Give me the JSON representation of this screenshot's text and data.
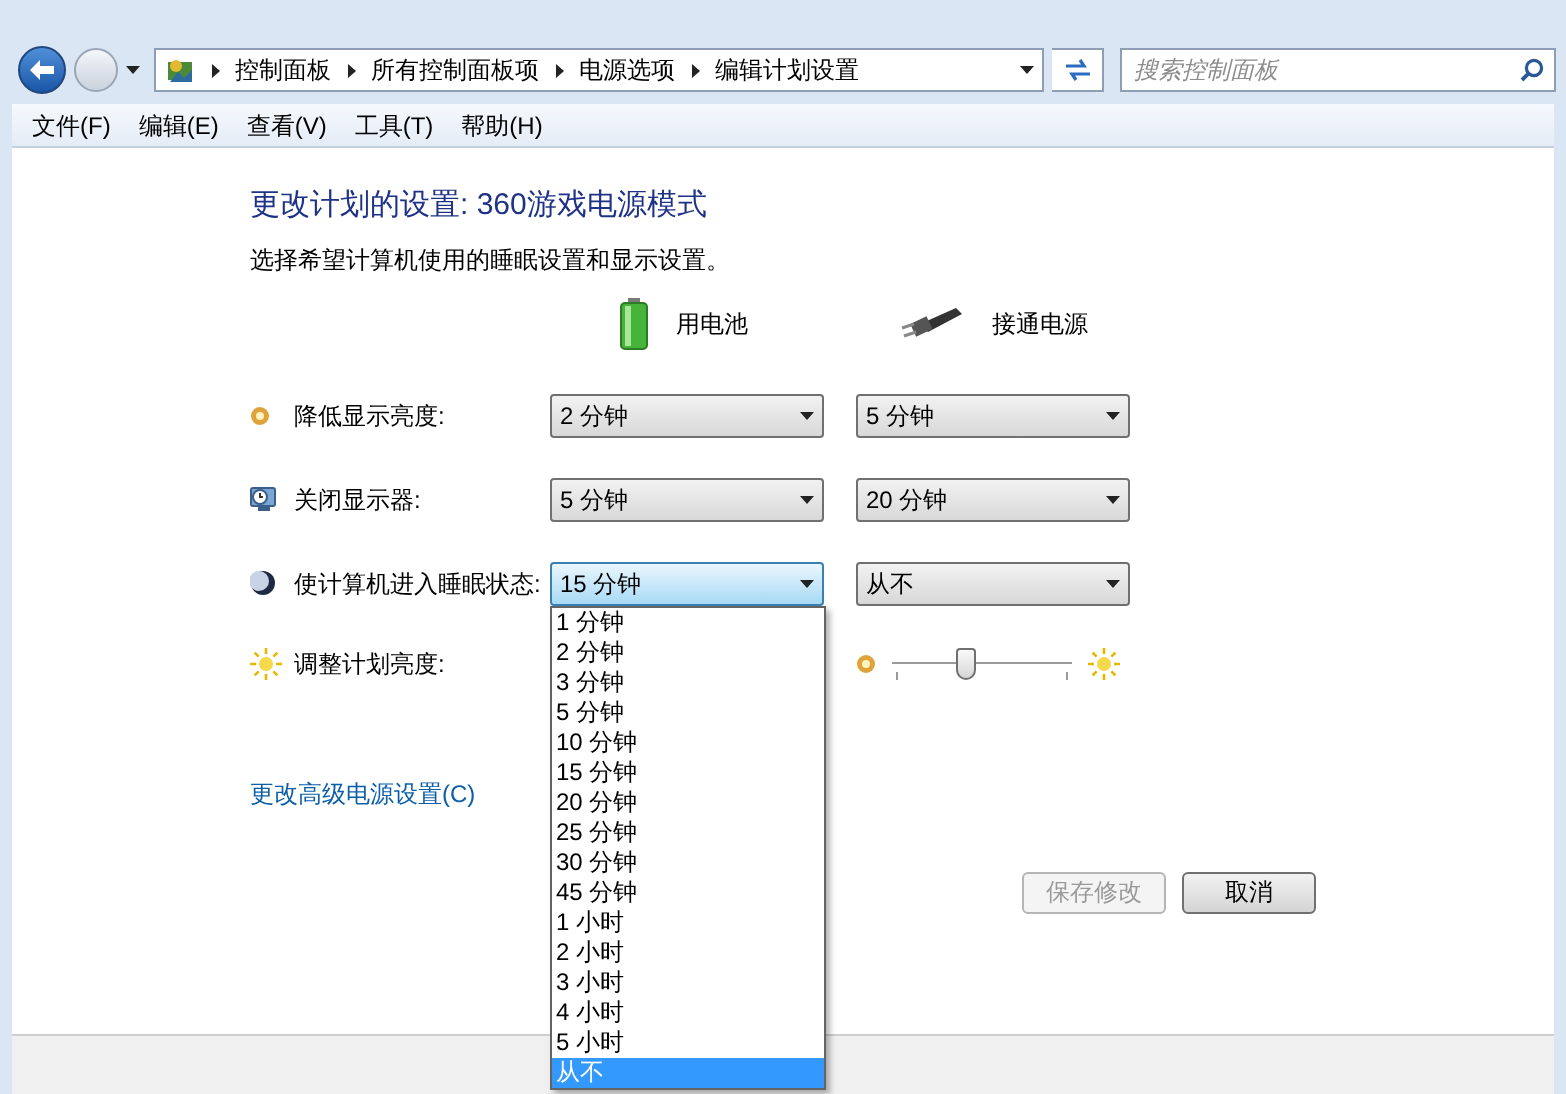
{
  "address_bar": {
    "breadcrumbs": [
      "控制面板",
      "所有控制面板项",
      "电源选项",
      "编辑计划设置"
    ]
  },
  "search": {
    "placeholder": "搜索控制面板"
  },
  "menu": [
    "文件(F)",
    "编辑(E)",
    "查看(V)",
    "工具(T)",
    "帮助(H)"
  ],
  "title": "更改计划的设置: 360游戏电源模式",
  "subtitle": "选择希望计算机使用的睡眠设置和显示设置。",
  "columns": [
    {
      "kind": "battery",
      "label": "用电池"
    },
    {
      "kind": "plug",
      "label": "接通电源"
    }
  ],
  "settings": [
    {
      "kind": "dim",
      "label": "降低显示亮度:",
      "battery": "2 分钟",
      "plugged_in": "5 分钟"
    },
    {
      "kind": "display",
      "label": "关闭显示器:",
      "battery": "5 分钟",
      "plugged_in": "20 分钟"
    },
    {
      "kind": "sleep",
      "label": "使计算机进入睡眠状态:",
      "battery": "15 分钟",
      "plugged_in": "从不",
      "battery_focused": true
    }
  ],
  "brightness": {
    "label": "调整计划亮度:",
    "plugged_in": {
      "level": 0.41
    }
  },
  "advanced_link": "更改高级电源设置(C)",
  "buttons": [
    {
      "label": "保存修改",
      "disabled": true
    },
    {
      "label": "取消",
      "disabled": false
    }
  ],
  "dropdown_options": [
    {
      "label": "1 分钟",
      "selected": false
    },
    {
      "label": "2 分钟",
      "selected": false
    },
    {
      "label": "3 分钟",
      "selected": false
    },
    {
      "label": "5 分钟",
      "selected": false
    },
    {
      "label": "10 分钟",
      "selected": false
    },
    {
      "label": "15 分钟",
      "selected": false
    },
    {
      "label": "20 分钟",
      "selected": false
    },
    {
      "label": "25 分钟",
      "selected": false
    },
    {
      "label": "30 分钟",
      "selected": false
    },
    {
      "label": "45 分钟",
      "selected": false
    },
    {
      "label": "1 小时",
      "selected": false
    },
    {
      "label": "2 小时",
      "selected": false
    },
    {
      "label": "3 小时",
      "selected": false
    },
    {
      "label": "4 小时",
      "selected": false
    },
    {
      "label": "5 小时",
      "selected": false
    },
    {
      "label": "从不",
      "selected": true
    }
  ]
}
